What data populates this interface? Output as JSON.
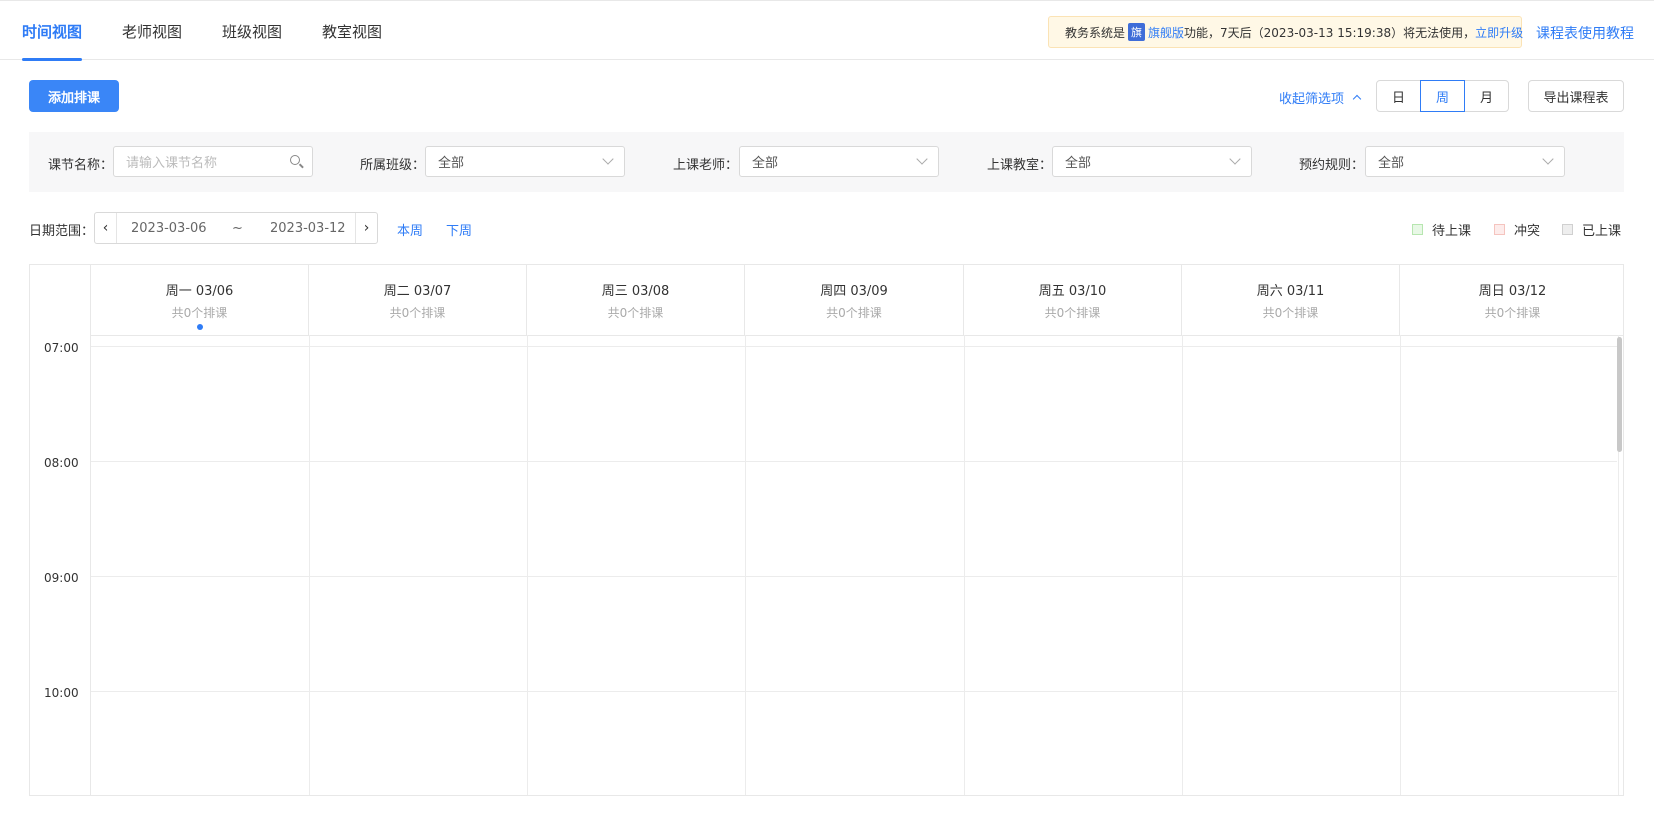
{
  "tabs": [
    {
      "label": "时间视图",
      "active": true
    },
    {
      "label": "老师视图",
      "active": false
    },
    {
      "label": "班级视图",
      "active": false
    },
    {
      "label": "教室视图",
      "active": false
    }
  ],
  "notice": {
    "prefix": "教务系统是",
    "flag": "旗",
    "edition": "旗舰版",
    "middle": "功能，7天后（2023-03-13 15:19:38）将无法使用，",
    "upgrade": "立即升级"
  },
  "tutorial_link": "课程表使用教程",
  "toolbar": {
    "add_button": "添加排课",
    "collapse_filters": "收起筛选项",
    "view_modes": [
      "日",
      "周",
      "月"
    ],
    "active_view": "周",
    "export_button": "导出课程表"
  },
  "filters": {
    "lesson_name": {
      "label": "课节名称：",
      "placeholder": "请输入课节名称"
    },
    "class": {
      "label": "所属班级：",
      "value": "全部"
    },
    "teacher": {
      "label": "上课老师：",
      "value": "全部"
    },
    "classroom": {
      "label": "上课教室：",
      "value": "全部"
    },
    "booking_rule": {
      "label": "预约规则：",
      "value": "全部"
    }
  },
  "date_range": {
    "label": "日期范围：",
    "start": "2023-03-06",
    "separator": "~",
    "end": "2023-03-12",
    "this_week": "本周",
    "next_week": "下周"
  },
  "legend": [
    {
      "label": "待上课",
      "color": "#e8f8e6",
      "border": "#b7e6b0"
    },
    {
      "label": "冲突",
      "color": "#fdeceb",
      "border": "#f5c4bf"
    },
    {
      "label": "已上课",
      "color": "#eeeeee",
      "border": "#d0d0d0"
    }
  ],
  "calendar": {
    "days": [
      {
        "date": "周一 03/06",
        "count": "共0个排课",
        "today": true
      },
      {
        "date": "周二 03/07",
        "count": "共0个排课",
        "today": false
      },
      {
        "date": "周三 03/08",
        "count": "共0个排课",
        "today": false
      },
      {
        "date": "周四 03/09",
        "count": "共0个排课",
        "today": false
      },
      {
        "date": "周五 03/10",
        "count": "共0个排课",
        "today": false
      },
      {
        "date": "周六 03/11",
        "count": "共0个排课",
        "today": false
      },
      {
        "date": "周日 03/12",
        "count": "共0个排课",
        "today": false
      }
    ],
    "hours": [
      "07:00",
      "08:00",
      "09:00",
      "10:00"
    ]
  },
  "colors": {
    "accent": "#2f7cf6",
    "primary_button": "#3a86f7"
  }
}
